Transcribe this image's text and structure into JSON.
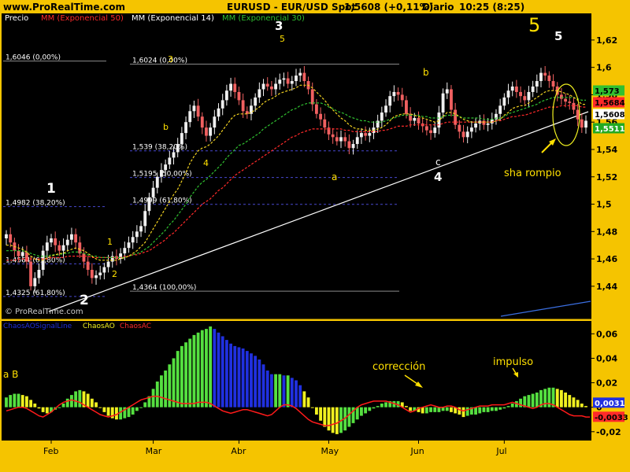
{
  "header": {
    "site": "www.ProRealTime.com",
    "instrument": "EURUSD - EUR/USD Spot",
    "quote": "1,5608 (+0,11%)",
    "period": "Diario",
    "time": "10:25 (8:25)"
  },
  "legend": {
    "precio": "Precio",
    "mm50": "MM (Exponencial 50)",
    "mm14": "MM (Exponencial 14)",
    "mm30": "MM (Exponencial 30)"
  },
  "watermark": "© ProRealTime.com",
  "indicator_legend": {
    "signal": "ChaosAOSignalLine",
    "ao": "ChaosAO",
    "ac": "ChaosAC"
  },
  "colors": {
    "background": "#000000",
    "frame": "#f5c400",
    "up_candle": "#f0f0f0",
    "down_candle": "#f06060",
    "mm50": "#ff2a2a",
    "mm14": "#f0d020",
    "mm30": "#30c030",
    "fib_line": "#4848d0",
    "ao_up": "#55e040",
    "ao_down": "#f0f020",
    "ao_blue": "#2030e0",
    "ac": "#ff1a1a",
    "annotation": "#ffe000",
    "label": "#ffffff"
  },
  "chart_data": [
    {
      "type": "candlestick",
      "y_ticks": [
        "1,62",
        "1,6",
        "1,58",
        "1,56",
        "1,54",
        "1,52",
        "1,5",
        "1,48",
        "1,46",
        "1,44"
      ],
      "y_range": [
        1.429,
        1.632
      ],
      "x_ticks": [
        "Feb",
        "Mar",
        "Abr",
        "May",
        "Jun",
        "Jul"
      ],
      "price_tags": [
        {
          "label": "1,573",
          "value": 1.573,
          "color": "#30c030",
          "text_color": "#000000"
        },
        {
          "label": "1,5684",
          "value": 1.5684,
          "color": "#ff2a2a",
          "text_color": "#000000"
        },
        {
          "label": "1,5608",
          "value": 1.5608,
          "color": "#ffffff",
          "text_color": "#000000"
        },
        {
          "label": "1,5511",
          "value": 1.5511,
          "color": "#22aa22",
          "text_color": "#ffffff"
        }
      ],
      "close": [
        1.478,
        1.472,
        1.466,
        1.462,
        1.465,
        1.458,
        1.44,
        1.446,
        1.452,
        1.466,
        1.472,
        1.475,
        1.47,
        1.466,
        1.47,
        1.474,
        1.478,
        1.472,
        1.464,
        1.458,
        1.452,
        1.446,
        1.448,
        1.45,
        1.454,
        1.458,
        1.462,
        1.46,
        1.464,
        1.468,
        1.472,
        1.476,
        1.48,
        1.484,
        1.495,
        1.505,
        1.512,
        1.52,
        1.525,
        1.529,
        1.534,
        1.538,
        1.544,
        1.552,
        1.56,
        1.568,
        1.572,
        1.564,
        1.556,
        1.55,
        1.556,
        1.564,
        1.57,
        1.576,
        1.583,
        1.588,
        1.582,
        1.576,
        1.568,
        1.566,
        1.572,
        1.578,
        1.584,
        1.588,
        1.586,
        1.584,
        1.588,
        1.591,
        1.592,
        1.588,
        1.59,
        1.594,
        1.596,
        1.59,
        1.584,
        1.573,
        1.566,
        1.562,
        1.556,
        1.551,
        1.549,
        1.546,
        1.549,
        1.546,
        1.541,
        1.544,
        1.549,
        1.552,
        1.55,
        1.552,
        1.556,
        1.561,
        1.567,
        1.572,
        1.579,
        1.582,
        1.58,
        1.576,
        1.566,
        1.561,
        1.563,
        1.559,
        1.557,
        1.554,
        1.552,
        1.556,
        1.567,
        1.581,
        1.584,
        1.569,
        1.558,
        1.553,
        1.549,
        1.553,
        1.556,
        1.559,
        1.561,
        1.558,
        1.559,
        1.562,
        1.566,
        1.572,
        1.578,
        1.583,
        1.586,
        1.582,
        1.579,
        1.576,
        1.582,
        1.586,
        1.59,
        1.596,
        1.594,
        1.59,
        1.586,
        1.58,
        1.577,
        1.575,
        1.574,
        1.569,
        1.562,
        1.556,
        1.561
      ],
      "ema14": [
        1.47,
        1.47,
        1.469,
        1.468,
        1.467,
        1.465,
        1.462,
        1.46,
        1.459,
        1.459,
        1.461,
        1.462,
        1.463,
        1.464,
        1.464,
        1.466,
        1.467,
        1.468,
        1.467,
        1.466,
        1.464,
        1.462,
        1.46,
        1.459,
        1.459,
        1.459,
        1.459,
        1.459,
        1.46,
        1.461,
        1.462,
        1.464,
        1.466,
        1.469,
        1.472,
        1.477,
        1.482,
        1.487,
        1.492,
        1.497,
        1.502,
        1.507,
        1.511,
        1.517,
        1.523,
        1.53,
        1.535,
        1.539,
        1.541,
        1.542,
        1.544,
        1.547,
        1.55,
        1.554,
        1.558,
        1.562,
        1.565,
        1.566,
        1.566,
        1.566,
        1.567,
        1.569,
        1.571,
        1.574,
        1.576,
        1.577,
        1.579,
        1.581,
        1.582,
        1.583,
        1.584,
        1.585,
        1.587,
        1.587,
        1.587,
        1.585,
        1.582,
        1.579,
        1.576,
        1.572,
        1.569,
        1.566,
        1.563,
        1.561,
        1.558,
        1.556,
        1.555,
        1.555,
        1.554,
        1.554,
        1.554,
        1.555,
        1.556,
        1.558,
        1.561,
        1.564,
        1.565,
        1.566,
        1.566,
        1.566,
        1.565,
        1.564,
        1.563,
        1.562,
        1.561,
        1.56,
        1.561,
        1.564,
        1.567,
        1.567,
        1.566,
        1.564,
        1.562,
        1.561,
        1.56,
        1.56,
        1.56,
        1.56,
        1.56,
        1.56,
        1.561,
        1.562,
        1.565,
        1.567,
        1.57,
        1.571,
        1.572,
        1.572,
        1.574,
        1.576,
        1.578,
        1.58,
        1.582,
        1.583,
        1.583,
        1.583,
        1.582,
        1.581,
        1.58,
        1.578,
        1.576,
        1.573,
        1.573
      ],
      "ema30": [
        1.466,
        1.466,
        1.466,
        1.466,
        1.466,
        1.465,
        1.464,
        1.463,
        1.462,
        1.462,
        1.462,
        1.463,
        1.463,
        1.463,
        1.464,
        1.464,
        1.465,
        1.465,
        1.465,
        1.464,
        1.463,
        1.462,
        1.462,
        1.461,
        1.461,
        1.461,
        1.461,
        1.461,
        1.461,
        1.461,
        1.462,
        1.463,
        1.464,
        1.465,
        1.467,
        1.469,
        1.472,
        1.475,
        1.478,
        1.481,
        1.485,
        1.488,
        1.492,
        1.496,
        1.5,
        1.505,
        1.509,
        1.513,
        1.516,
        1.518,
        1.521,
        1.524,
        1.527,
        1.53,
        1.534,
        1.537,
        1.54,
        1.543,
        1.544,
        1.546,
        1.548,
        1.55,
        1.552,
        1.555,
        1.557,
        1.559,
        1.561,
        1.563,
        1.565,
        1.567,
        1.569,
        1.57,
        1.572,
        1.573,
        1.574,
        1.574,
        1.574,
        1.574,
        1.573,
        1.571,
        1.57,
        1.568,
        1.567,
        1.566,
        1.564,
        1.563,
        1.562,
        1.561,
        1.561,
        1.56,
        1.56,
        1.56,
        1.56,
        1.561,
        1.562,
        1.563,
        1.564,
        1.565,
        1.565,
        1.565,
        1.565,
        1.565,
        1.564,
        1.564,
        1.563,
        1.563,
        1.563,
        1.564,
        1.565,
        1.565,
        1.565,
        1.564,
        1.563,
        1.563,
        1.563,
        1.563,
        1.563,
        1.562,
        1.562,
        1.562,
        1.563,
        1.563,
        1.564,
        1.566,
        1.567,
        1.568,
        1.569,
        1.57,
        1.571,
        1.572,
        1.573,
        1.575,
        1.576,
        1.577,
        1.578,
        1.578,
        1.578,
        1.578,
        1.578,
        1.578,
        1.577,
        1.576,
        1.576
      ],
      "ema50": [
        1.459,
        1.459,
        1.459,
        1.46,
        1.46,
        1.46,
        1.46,
        1.46,
        1.46,
        1.46,
        1.46,
        1.461,
        1.461,
        1.461,
        1.461,
        1.462,
        1.462,
        1.462,
        1.462,
        1.462,
        1.462,
        1.461,
        1.461,
        1.461,
        1.461,
        1.461,
        1.461,
        1.461,
        1.461,
        1.462,
        1.462,
        1.463,
        1.463,
        1.464,
        1.465,
        1.466,
        1.468,
        1.47,
        1.472,
        1.474,
        1.477,
        1.479,
        1.482,
        1.485,
        1.488,
        1.491,
        1.494,
        1.497,
        1.5,
        1.502,
        1.504,
        1.507,
        1.51,
        1.512,
        1.515,
        1.518,
        1.521,
        1.523,
        1.525,
        1.527,
        1.529,
        1.531,
        1.533,
        1.535,
        1.537,
        1.539,
        1.541,
        1.543,
        1.545,
        1.547,
        1.549,
        1.55,
        1.552,
        1.553,
        1.554,
        1.555,
        1.555,
        1.555,
        1.555,
        1.555,
        1.555,
        1.555,
        1.555,
        1.554,
        1.554,
        1.553,
        1.553,
        1.553,
        1.553,
        1.553,
        1.553,
        1.553,
        1.554,
        1.554,
        1.555,
        1.556,
        1.557,
        1.557,
        1.557,
        1.558,
        1.558,
        1.558,
        1.558,
        1.558,
        1.558,
        1.558,
        1.558,
        1.559,
        1.56,
        1.56,
        1.56,
        1.56,
        1.56,
        1.56,
        1.56,
        1.56,
        1.56,
        1.56,
        1.56,
        1.56,
        1.561,
        1.561,
        1.562,
        1.563,
        1.564,
        1.564,
        1.565,
        1.565,
        1.566,
        1.567,
        1.568,
        1.569,
        1.57,
        1.571,
        1.571,
        1.571,
        1.572,
        1.572,
        1.572,
        1.572,
        1.572,
        1.571,
        1.571
      ],
      "fib_levels": [
        {
          "label": "1,6046 (0,00%)",
          "value": 1.6046,
          "style": "solid"
        },
        {
          "label": "1,4982 (38,20%)",
          "value": 1.4982,
          "style": "dashed"
        },
        {
          "label": "1,4564 (61,80%)",
          "value": 1.4564,
          "style": "dashed"
        },
        {
          "label": "1,4325 (61,80%)",
          "value": 1.4325,
          "style": "dashed"
        },
        {
          "label": "1,6024 (0,00%)",
          "value": 1.6024,
          "style": "solid"
        },
        {
          "label": "1,539 (38,20%)",
          "value": 1.539,
          "style": "dashed"
        },
        {
          "label": "1,5195 (50,00%)",
          "value": 1.5195,
          "style": "dashed"
        },
        {
          "label": "1,4999 (61,80%)",
          "value": 1.4999,
          "style": "dashed"
        },
        {
          "label": "1,4364 (100,00%)",
          "value": 1.4364,
          "style": "solid"
        }
      ],
      "wave_labels": [
        {
          "text": "1",
          "color": "white"
        },
        {
          "text": "2",
          "color": "white"
        },
        {
          "text": "3",
          "color": "white"
        },
        {
          "text": "4",
          "color": "white"
        },
        {
          "text": "5",
          "color": "yellow"
        },
        {
          "text": "5",
          "color": "white"
        },
        {
          "text": "1",
          "color": "yellow"
        },
        {
          "text": "2",
          "color": "yellow"
        },
        {
          "text": "3",
          "color": "yellow"
        },
        {
          "text": "4",
          "color": "yellow"
        },
        {
          "text": "5",
          "color": "yellow"
        },
        {
          "text": "a",
          "color": "yellow"
        },
        {
          "text": "b",
          "color": "yellow"
        },
        {
          "text": "b",
          "color": "yellow"
        },
        {
          "text": "c",
          "color": "white"
        }
      ],
      "annotations": [
        "sha rompio"
      ]
    },
    {
      "type": "bar",
      "y_ticks": [
        "0,06",
        "0,04",
        "0,02",
        "0",
        "-0,02"
      ],
      "y_range": [
        -0.024,
        0.066
      ],
      "value_tags": [
        {
          "label": "0,0031",
          "value": 0.0031,
          "color": "#2030e0"
        },
        {
          "label": "-0,0033",
          "value": -0.0033,
          "color": "#ff2a2a"
        }
      ],
      "ao": [
        0.008,
        0.01,
        0.011,
        0.011,
        0.01,
        0.009,
        0.006,
        0.003,
        -0.001,
        -0.004,
        -0.005,
        -0.004,
        -0.002,
        0.0,
        0.003,
        0.007,
        0.01,
        0.013,
        0.014,
        0.013,
        0.011,
        0.007,
        0.004,
        0.0,
        -0.004,
        -0.007,
        -0.009,
        -0.01,
        -0.01,
        -0.009,
        -0.008,
        -0.006,
        -0.003,
        0.0,
        0.004,
        0.009,
        0.015,
        0.021,
        0.026,
        0.03,
        0.035,
        0.04,
        0.046,
        0.05,
        0.053,
        0.056,
        0.059,
        0.061,
        0.063,
        0.064,
        0.066,
        0.064,
        0.061,
        0.058,
        0.055,
        0.052,
        0.05,
        0.049,
        0.048,
        0.046,
        0.044,
        0.042,
        0.039,
        0.035,
        0.03,
        0.027,
        0.027,
        0.027,
        0.026,
        0.026,
        0.024,
        0.022,
        0.018,
        0.013,
        0.008,
        0.0,
        -0.006,
        -0.011,
        -0.016,
        -0.019,
        -0.021,
        -0.022,
        -0.021,
        -0.019,
        -0.016,
        -0.013,
        -0.01,
        -0.007,
        -0.005,
        -0.003,
        -0.001,
        0.001,
        0.003,
        0.004,
        0.005,
        0.005,
        0.005,
        0.004,
        0.001,
        -0.003,
        -0.003,
        -0.004,
        -0.005,
        -0.005,
        -0.004,
        -0.004,
        -0.004,
        -0.003,
        -0.003,
        -0.004,
        -0.005,
        -0.006,
        -0.008,
        -0.007,
        -0.006,
        -0.006,
        -0.005,
        -0.004,
        -0.004,
        -0.003,
        -0.003,
        -0.002,
        -0.001,
        0.001,
        0.003,
        0.005,
        0.007,
        0.009,
        0.01,
        0.011,
        0.012,
        0.014,
        0.015,
        0.016,
        0.016,
        0.015,
        0.014,
        0.012,
        0.01,
        0.008,
        0.006,
        0.003,
        0.001
      ],
      "ac": [
        -0.003,
        -0.002,
        -0.001,
        0.0,
        0.0,
        -0.001,
        -0.003,
        -0.005,
        -0.007,
        -0.008,
        -0.006,
        -0.004,
        -0.001,
        0.002,
        0.004,
        0.005,
        0.006,
        0.005,
        0.004,
        0.002,
        0.0,
        -0.002,
        -0.004,
        -0.006,
        -0.007,
        -0.008,
        -0.007,
        -0.006,
        -0.004,
        -0.002,
        0.0,
        0.002,
        0.004,
        0.006,
        0.007,
        0.008,
        0.009,
        0.009,
        0.008,
        0.007,
        0.006,
        0.005,
        0.004,
        0.003,
        0.003,
        0.003,
        0.003,
        0.004,
        0.004,
        0.004,
        0.003,
        0.001,
        -0.001,
        -0.003,
        -0.004,
        -0.005,
        -0.004,
        -0.003,
        -0.002,
        -0.002,
        -0.003,
        -0.004,
        -0.005,
        -0.006,
        -0.007,
        -0.006,
        -0.003,
        0.0,
        0.002,
        0.002,
        0.001,
        -0.001,
        -0.004,
        -0.007,
        -0.01,
        -0.012,
        -0.013,
        -0.014,
        -0.015,
        -0.015,
        -0.014,
        -0.013,
        -0.011,
        -0.009,
        -0.006,
        -0.003,
        0.0,
        0.002,
        0.003,
        0.004,
        0.005,
        0.005,
        0.005,
        0.005,
        0.004,
        0.003,
        0.002,
        0.0,
        -0.002,
        -0.004,
        -0.003,
        -0.001,
        0.0,
        0.001,
        0.002,
        0.001,
        0.0,
        0.0,
        0.001,
        0.001,
        0.0,
        -0.002,
        -0.003,
        -0.002,
        -0.001,
        0.0,
        0.001,
        0.001,
        0.001,
        0.002,
        0.002,
        0.002,
        0.002,
        0.003,
        0.004,
        0.003,
        0.002,
        0.001,
        0.0,
        -0.001,
        0.0,
        0.002,
        0.003,
        0.003,
        0.002,
        0.0,
        -0.002,
        -0.004,
        -0.006,
        -0.007,
        -0.007,
        -0.007,
        -0.008,
        -0.008
      ],
      "annotations": [
        "a B",
        "corrección",
        "impulso"
      ]
    }
  ]
}
